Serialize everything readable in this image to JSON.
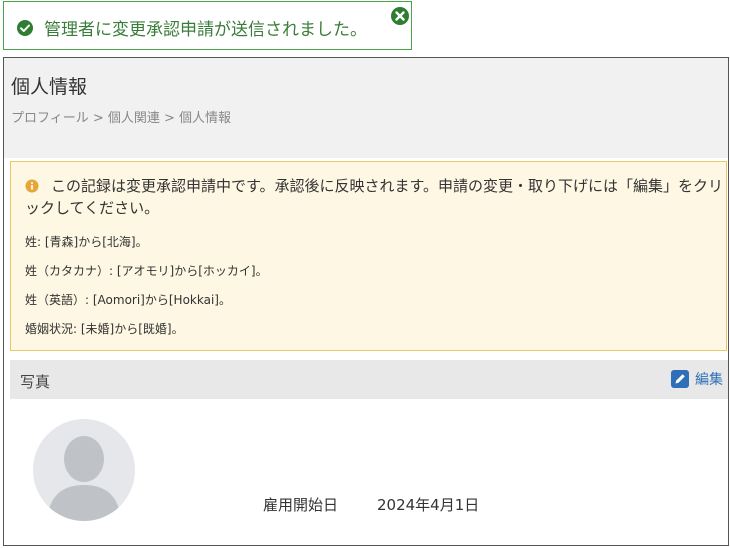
{
  "toast": {
    "message": "管理者に変更承認申請が送信されました。",
    "accent": "#46a546"
  },
  "page": {
    "title": "個人情報",
    "breadcrumb": "プロフィール > 個人関連 > 個人情報"
  },
  "alert": {
    "message": "この記録は変更承認申請中です。承認後に反映されます。申請の変更・取り下げには「編集」をクリックしてください。",
    "changes": [
      "姓: [青森]から[北海]。",
      "姓（カタカナ）: [アオモリ]から[ホッカイ]。",
      "姓（英語）: [Aomori]から[Hokkai]。",
      "婚姻状況: [未婚]から[既婚]。"
    ],
    "background": "#fdf7e3",
    "border": "#eac66b"
  },
  "photo_section": {
    "title": "写真",
    "edit_label": "編集",
    "edit_color": "#2e6fb7"
  },
  "employment": {
    "hire_date_label": "雇用開始日",
    "hire_date_value": "2024年4月1日"
  }
}
